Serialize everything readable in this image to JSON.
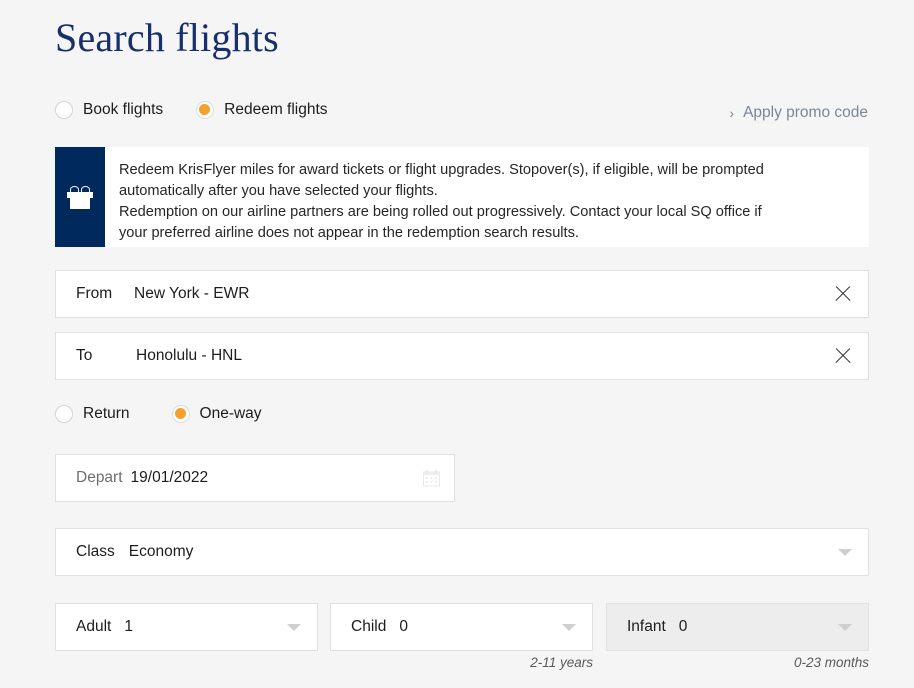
{
  "page": {
    "title": "Search flights",
    "background_color": "#f5f5f5"
  },
  "colors": {
    "brand_navy": "#002a5e",
    "title_navy": "#17306b",
    "accent_orange": "#f5a02d",
    "muted_text": "#6e6e6e",
    "link_grey": "#7b8698"
  },
  "trip_mode": {
    "options": [
      {
        "label": "Book flights",
        "selected": false
      },
      {
        "label": "Redeem flights",
        "selected": true
      }
    ]
  },
  "promo": {
    "chevron": "›",
    "label": "Apply promo code"
  },
  "banner": {
    "icon": "gift-icon",
    "lines": [
      "Redeem KrisFlyer miles for award tickets or flight upgrades. Stopover(s), if eligible, will be prompted",
      "automatically after you have selected your flights.",
      "Redemption on our airline partners are being rolled out progressively. Contact your local SQ office if",
      "your preferred airline does not appear in the redemption search results."
    ]
  },
  "form": {
    "from": {
      "label": "From",
      "value": "New York - EWR",
      "clear_icon": "close-icon"
    },
    "to": {
      "label": "To",
      "value": "Honolulu - HNL",
      "clear_icon": "close-icon"
    },
    "direction": {
      "options": [
        {
          "label": "Return",
          "selected": false
        },
        {
          "label": "One-way",
          "selected": true
        }
      ]
    },
    "depart": {
      "label": "Depart",
      "value": "19/01/2022",
      "icon": "calendar-icon"
    },
    "travel_class": {
      "label": "Class",
      "value": "Economy",
      "icon": "chevron-down-icon"
    },
    "passengers": [
      {
        "label": "Adult",
        "value": "1",
        "hint": "",
        "disabled": false
      },
      {
        "label": "Child",
        "value": "0",
        "hint": "2-11 years",
        "disabled": false
      },
      {
        "label": "Infant",
        "value": "0",
        "hint": "0-23 months",
        "disabled": true
      }
    ]
  }
}
